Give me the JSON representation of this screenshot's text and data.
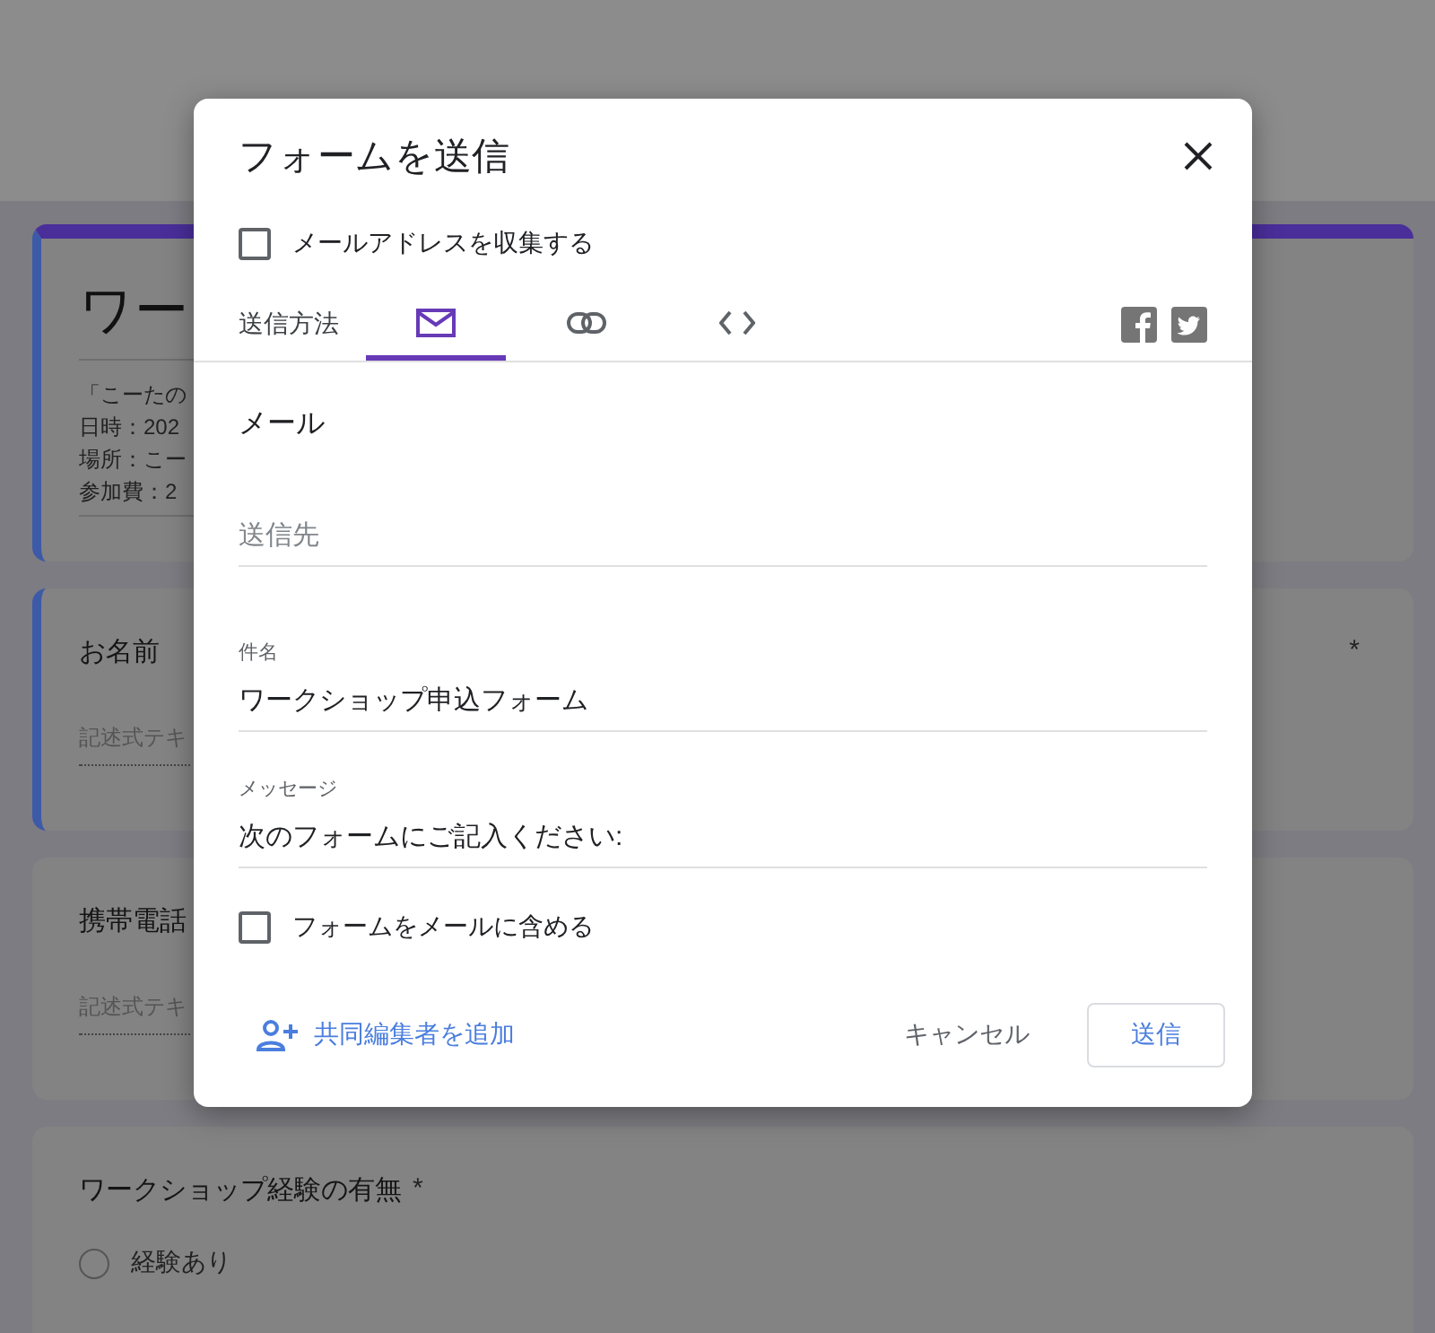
{
  "form": {
    "title": "ワー",
    "description_lines": [
      "「こーたの",
      "日時：202",
      "場所：こー",
      "参加費：2"
    ],
    "questions": [
      {
        "kind": "short_answer",
        "title": "お名前",
        "required_mark": "*",
        "selected": true,
        "placeholder": "記述式テキ"
      },
      {
        "kind": "short_answer",
        "title": "携帯電話",
        "selected": false,
        "placeholder": "記述式テキ"
      },
      {
        "kind": "multiple_choice",
        "title": "ワークショップ経験の有無",
        "required_mark": "*",
        "selected": false,
        "options": [
          {
            "label": "経験あり",
            "selected": false
          }
        ]
      }
    ]
  },
  "dialog": {
    "title": "フォームを送信",
    "collect_email": {
      "label": "メールアドレスを収集する",
      "checked": false
    },
    "send_via_label": "送信方法",
    "tabs": [
      {
        "kind": "email",
        "selected": true
      },
      {
        "kind": "link",
        "selected": false
      },
      {
        "kind": "embed",
        "selected": false
      }
    ],
    "section_title": "メール",
    "fields": [
      {
        "placeholder": "送信先"
      },
      {
        "label": "件名",
        "value": "ワークショップ申込フォーム"
      },
      {
        "label": "メッセージ",
        "value": "次のフォームにご記入ください:"
      }
    ],
    "include_form": {
      "label": "フォームをメールに含める",
      "checked": false
    },
    "add_collaborators": "共同編集者を追加",
    "cancel": "キャンセル",
    "send": "送信"
  }
}
